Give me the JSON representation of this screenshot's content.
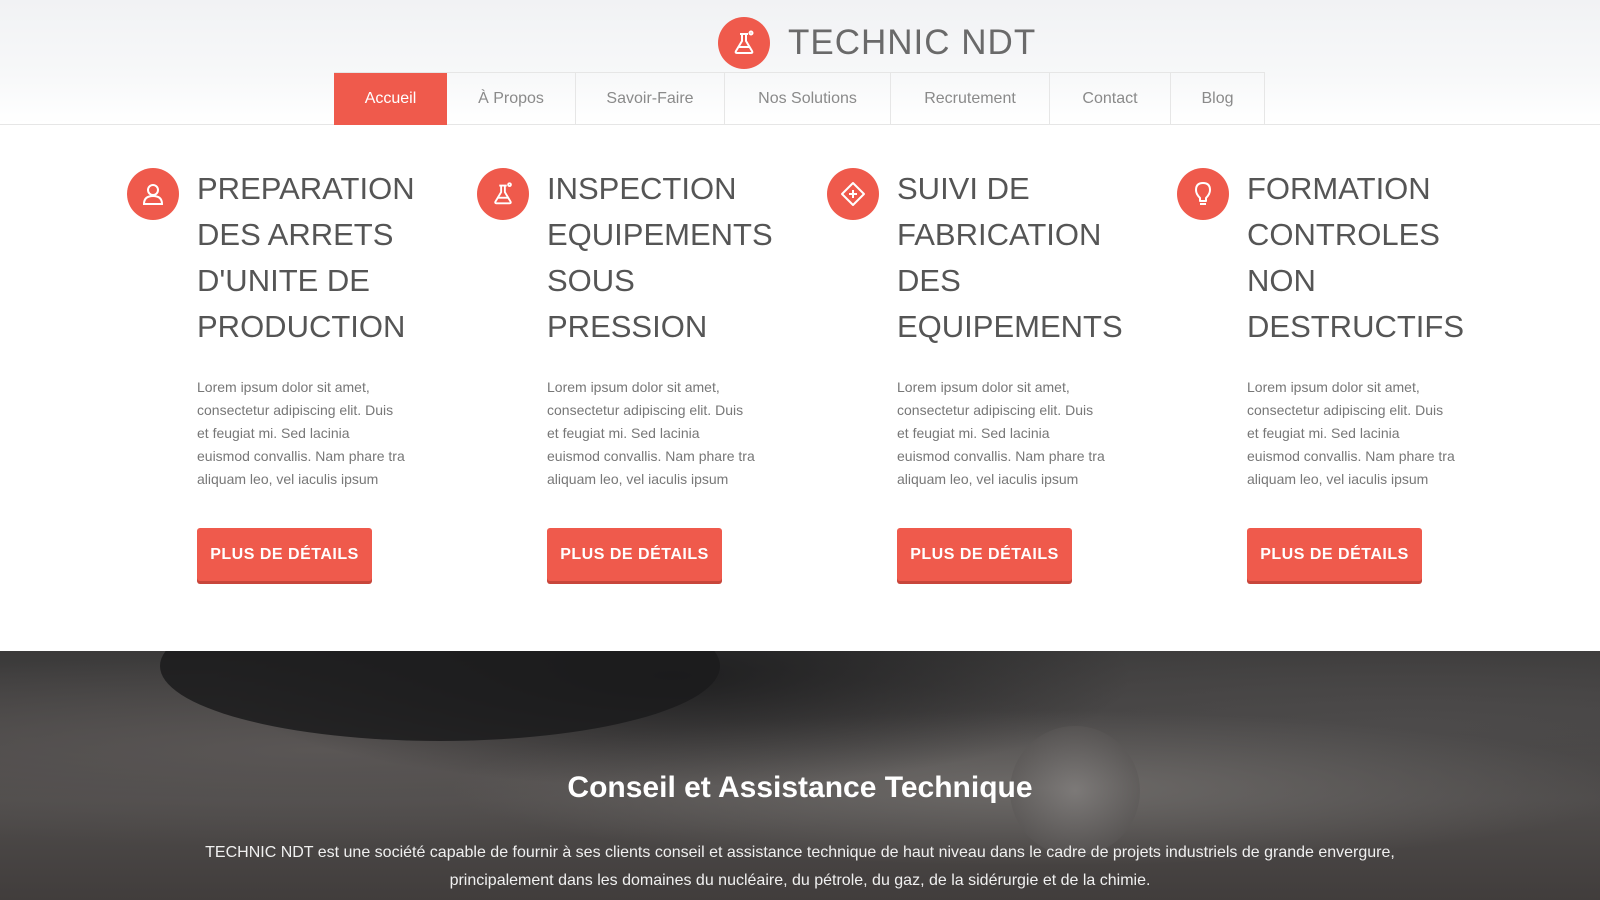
{
  "brand": {
    "name": "TECHNIC NDT",
    "logo_icon": "flask-icon",
    "accent": "#ef5a4c"
  },
  "nav": {
    "items": [
      {
        "label": "Accueil",
        "active": true
      },
      {
        "label": "À Propos"
      },
      {
        "label": "Savoir-Faire"
      },
      {
        "label": "Nos Solutions"
      },
      {
        "label": "Recrutement"
      },
      {
        "label": "Contact"
      },
      {
        "label": "Blog"
      }
    ]
  },
  "services": [
    {
      "icon": "user-icon",
      "title_lines": [
        "PREPARATION",
        "DES ARRETS",
        "D'UNITE DE",
        "PRODUCTION"
      ],
      "desc_lines": [
        "Lorem ipsum dolor sit amet,",
        "consectetur adipiscing elit. Duis",
        "et feugiat mi. Sed lacinia",
        "euismod convallis. Nam phare tra",
        "aliquam leo, vel iaculis ipsum"
      ],
      "button": "PLUS DE DÉTAILS"
    },
    {
      "icon": "flask-icon",
      "title_lines": [
        "INSPECTION",
        "EQUIPEMENTS",
        "SOUS",
        "PRESSION"
      ],
      "desc_lines": [
        "Lorem ipsum dolor sit amet,",
        "consectetur adipiscing elit. Duis",
        "et feugiat mi. Sed lacinia",
        "euismod convallis. Nam phare tra",
        "aliquam leo, vel iaculis ipsum"
      ],
      "button": "PLUS DE DÉTAILS"
    },
    {
      "icon": "ticket-icon",
      "title_lines": [
        "SUIVI DE",
        "FABRICATION",
        "DES",
        "EQUIPEMENTS"
      ],
      "desc_lines": [
        "Lorem ipsum dolor sit amet,",
        "consectetur adipiscing elit. Duis",
        "et feugiat mi. Sed lacinia",
        "euismod convallis. Nam phare tra",
        "aliquam leo, vel iaculis ipsum"
      ],
      "button": "PLUS DE DÉTAILS"
    },
    {
      "icon": "lightbulb-icon",
      "title_lines": [
        "FORMATION",
        "CONTROLES",
        "NON",
        "DESTRUCTIFS"
      ],
      "desc_lines": [
        "Lorem ipsum dolor sit amet,",
        "consectetur adipiscing elit. Duis",
        "et feugiat mi. Sed lacinia",
        "euismod convallis. Nam phare tra",
        "aliquam leo, vel iaculis ipsum"
      ],
      "button": "PLUS DE DÉTAILS"
    }
  ],
  "banner": {
    "title": "Conseil et Assistance Technique",
    "text_lines": [
      "TECHNIC NDT est une société capable de fournir à ses clients conseil et assistance technique de haut niveau dans le cadre de projets industriels de grande envergure,",
      "principalement dans les domaines du nucléaire, du pétrole, du gaz, de la sidérurgie et de la chimie."
    ]
  }
}
